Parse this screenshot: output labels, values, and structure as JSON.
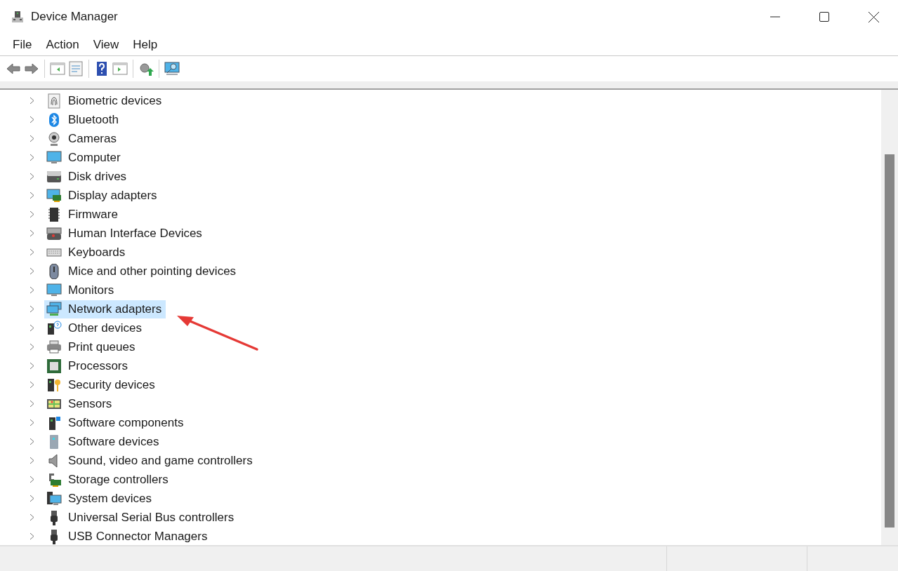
{
  "window": {
    "title": "Device Manager"
  },
  "menu": [
    "File",
    "Action",
    "View",
    "Help"
  ],
  "tree": {
    "items": [
      {
        "label": "Biometric devices",
        "kind": "fingerprint",
        "selected": false
      },
      {
        "label": "Bluetooth",
        "kind": "bluetooth",
        "selected": false
      },
      {
        "label": "Cameras",
        "kind": "camera",
        "selected": false
      },
      {
        "label": "Computer",
        "kind": "monitor",
        "selected": false
      },
      {
        "label": "Disk drives",
        "kind": "disk",
        "selected": false
      },
      {
        "label": "Display adapters",
        "kind": "display",
        "selected": false
      },
      {
        "label": "Firmware",
        "kind": "chip",
        "selected": false
      },
      {
        "label": "Human Interface Devices",
        "kind": "hid",
        "selected": false
      },
      {
        "label": "Keyboards",
        "kind": "keyboard",
        "selected": false
      },
      {
        "label": "Mice and other pointing devices",
        "kind": "mouse",
        "selected": false
      },
      {
        "label": "Monitors",
        "kind": "monitor",
        "selected": false
      },
      {
        "label": "Network adapters",
        "kind": "network",
        "selected": true
      },
      {
        "label": "Other devices",
        "kind": "unknown",
        "selected": false
      },
      {
        "label": "Print queues",
        "kind": "printer",
        "selected": false
      },
      {
        "label": "Processors",
        "kind": "processor",
        "selected": false
      },
      {
        "label": "Security devices",
        "kind": "security",
        "selected": false
      },
      {
        "label": "Sensors",
        "kind": "sensor",
        "selected": false
      },
      {
        "label": "Software components",
        "kind": "component",
        "selected": false
      },
      {
        "label": "Software devices",
        "kind": "software",
        "selected": false
      },
      {
        "label": "Sound, video and game controllers",
        "kind": "speaker",
        "selected": false
      },
      {
        "label": "Storage controllers",
        "kind": "storage",
        "selected": false
      },
      {
        "label": "System devices",
        "kind": "system",
        "selected": false
      },
      {
        "label": "Universal Serial Bus controllers",
        "kind": "usb",
        "selected": false
      },
      {
        "label": "USB Connector Managers",
        "kind": "usb",
        "selected": false
      }
    ]
  }
}
